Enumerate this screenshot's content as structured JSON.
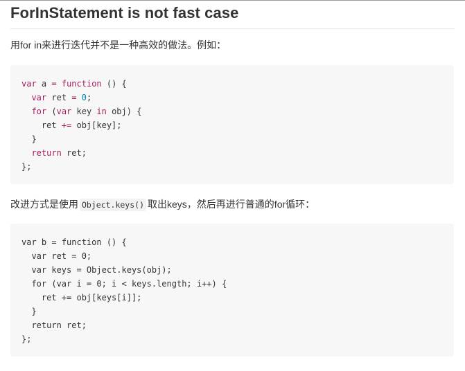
{
  "section": {
    "title": "ForInStatement is not fast case",
    "intro": "用for in来进行迭代并不是一种高效的做法。例如：",
    "alt_before": "改进方式是使用",
    "alt_code": "Object.keys()",
    "alt_after": "取出keys，然后再进行普通的for循环："
  },
  "code_block_1": {
    "lines": [
      "var a = function () {",
      "  var ret = 0;",
      "  for (var key in obj) {",
      "    ret += obj[key];",
      "  }",
      "  return ret;",
      "};"
    ]
  },
  "code_block_2": {
    "lines": [
      "var b = function () {",
      "  var ret = 0;",
      "  var keys = Object.keys(obj);",
      "  for (var i = 0; i < keys.length; i++) {",
      "    ret += obj[keys[i]];",
      "  }",
      "  return ret;",
      "};"
    ]
  },
  "colors": {
    "keyword": "#a71d5d",
    "number": "#0086b3",
    "code_background": "#f7f7f7",
    "text": "#333333"
  }
}
